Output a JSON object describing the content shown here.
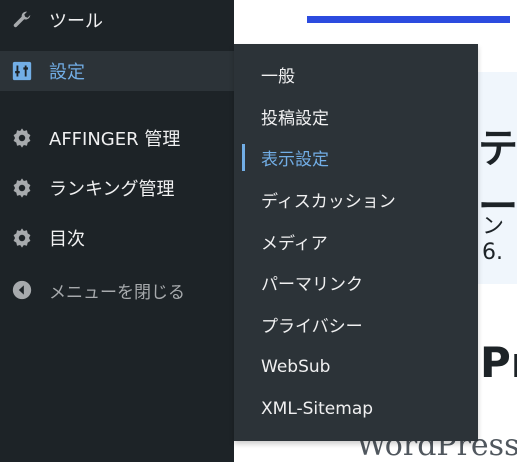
{
  "sidebar": {
    "items": [
      {
        "label": "ツール",
        "icon": "wrench-icon"
      },
      {
        "label": "設定",
        "icon": "settings-icon"
      },
      {
        "label": "AFFINGER 管理",
        "icon": "gear-icon"
      },
      {
        "label": "ランキング管理",
        "icon": "gear-icon"
      },
      {
        "label": "目次",
        "icon": "gear-icon"
      },
      {
        "label": "メニューを閉じる",
        "icon": "collapse-icon"
      }
    ]
  },
  "flyout": {
    "items": [
      {
        "label": "一般"
      },
      {
        "label": "投稿設定"
      },
      {
        "label": "表示設定"
      },
      {
        "label": "ディスカッション"
      },
      {
        "label": "メディア"
      },
      {
        "label": "パーマリンク"
      },
      {
        "label": "プライバシー"
      },
      {
        "label": "WebSub"
      },
      {
        "label": "XML-Sitemap"
      }
    ],
    "current": "表示設定"
  },
  "main": {
    "notice_title": "テー",
    "notice_sub": "ン 6.",
    "big_heading": "Pr",
    "wp_word": "WordPress"
  },
  "colors": {
    "sidebar_bg": "#1d2327",
    "flyout_bg": "#2c3338",
    "accent": "#72aee6",
    "blue_bar": "#2c4bdf"
  }
}
